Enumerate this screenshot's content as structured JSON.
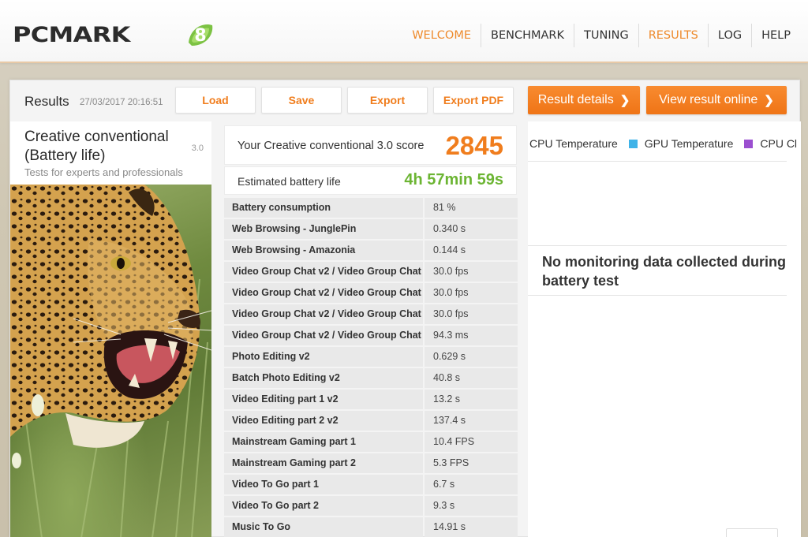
{
  "app": {
    "logo_text": "PCMARK",
    "logo_badge": "8",
    "colors": {
      "accent": "#f07d1d",
      "green": "#6cb533"
    }
  },
  "nav": {
    "items": [
      {
        "label": "WELCOME",
        "active": true
      },
      {
        "label": "BENCHMARK",
        "active": false
      },
      {
        "label": "TUNING",
        "active": false
      },
      {
        "label": "RESULTS",
        "active": true
      },
      {
        "label": "LOG",
        "active": false
      },
      {
        "label": "HELP",
        "active": false
      }
    ]
  },
  "toolbar": {
    "title": "Results",
    "date": "27/03/2017 20:16:51",
    "load_label": "Load",
    "save_label": "Save",
    "export_label": "Export",
    "export_pdf_label": "Export PDF",
    "result_details_label": "Result details",
    "view_online_label": "View result online",
    "chevron": "❯"
  },
  "test": {
    "name": "Creative conventional (Battery life)",
    "version": "3.0",
    "description": "Tests for experts and professionals",
    "image": "leopard-photo"
  },
  "score": {
    "label": "Your Creative conventional 3.0 score",
    "value": "2845",
    "battery_label": "Estimated battery life",
    "battery_value": "4h 57min 59s"
  },
  "results": [
    {
      "name": "Battery consumption",
      "value": "81 %"
    },
    {
      "name": "Web Browsing - JunglePin",
      "value": "0.340 s"
    },
    {
      "name": "Web Browsing - Amazonia",
      "value": "0.144 s"
    },
    {
      "name": "Video Group Chat v2 / Video Group Chat",
      "value": "30.0 fps"
    },
    {
      "name": "Video Group Chat v2 / Video Group Chat",
      "value": "30.0 fps"
    },
    {
      "name": "Video Group Chat v2 / Video Group Chat",
      "value": "30.0 fps"
    },
    {
      "name": "Video Group Chat v2 / Video Group Chat",
      "value": "94.3 ms"
    },
    {
      "name": "Photo Editing v2",
      "value": "0.629 s"
    },
    {
      "name": "Batch Photo Editing v2",
      "value": "40.8 s"
    },
    {
      "name": "Video Editing part 1 v2",
      "value": "13.2 s"
    },
    {
      "name": "Video Editing part 2 v2",
      "value": "137.4 s"
    },
    {
      "name": "Mainstream Gaming part 1",
      "value": "10.4 FPS"
    },
    {
      "name": "Mainstream Gaming part 2",
      "value": "5.3 FPS"
    },
    {
      "name": "Video To Go part 1",
      "value": "6.7 s"
    },
    {
      "name": "Video To Go part 2",
      "value": "9.3 s"
    },
    {
      "name": "Music To Go",
      "value": "14.91 s"
    }
  ],
  "monitoring": {
    "legend": [
      {
        "label": "CPU Temperature",
        "color": "#ffffff"
      },
      {
        "label": "GPU Temperature",
        "color": "#3fb3e8"
      },
      {
        "label": "CPU Cl",
        "color": "#9b4fd0"
      }
    ],
    "no_data_text": "No monitoring data collected during battery test"
  }
}
